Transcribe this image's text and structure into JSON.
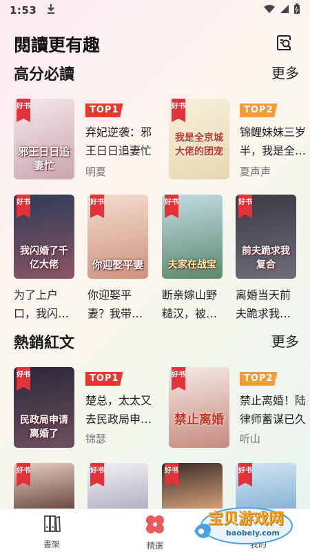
{
  "status": {
    "time": "1:53"
  },
  "header": {
    "title": "閱讀更有趣"
  },
  "sections": [
    {
      "title": "高分必讀",
      "more": "更多"
    },
    {
      "title": "熱銷紅文",
      "more": "更多"
    }
  ],
  "badge": "好书",
  "top_books_1": [
    {
      "rank": "TOP1",
      "title_line1": "弃妃逆袭：邪",
      "title_line2": "王日日追妻忙",
      "author": "明夏",
      "cover_text": "邪王日日追妻忙",
      "colors": [
        "#f3e6e8",
        "#c9a3ad"
      ]
    },
    {
      "rank": "TOP2",
      "title_line1": "锦鲤妹妹三岁",
      "title_line2": "半，我是全…",
      "author": "夏声声",
      "cover_text": "我是全京城大佬的团宠",
      "colors": [
        "#f6f0da",
        "#e9dcb7"
      ]
    }
  ],
  "grid_1": [
    {
      "cover_text": "我闪婚了千亿大佬",
      "line1": "为了上户",
      "line2": "口，我闪…",
      "colors": [
        "#32405a",
        "#8a5565"
      ]
    },
    {
      "cover_text": "你迎娶平妻",
      "line1": "你迎娶平",
      "line2": "妻？我带…",
      "colors": [
        "#f0d6c6",
        "#d49b87"
      ]
    },
    {
      "cover_text": "夫家在战宝",
      "line1": "断亲嫁山野",
      "line2": "糙汉，被…",
      "colors": [
        "#bcd7e0",
        "#5f8f73"
      ]
    },
    {
      "cover_text": "前夫跪求我复合",
      "line1": "离婚当天前",
      "line2": "夫跪求我…",
      "colors": [
        "#3e3a48",
        "#6d6a78"
      ]
    }
  ],
  "top_books_2": [
    {
      "rank": "TOP1",
      "title_line1": "楚总，太太又",
      "title_line2": "去民政局申…",
      "author": "锦瑟",
      "cover_text": "民政局申请离婚了",
      "colors": [
        "#2c2a3a",
        "#6b4e5e"
      ]
    },
    {
      "rank": "TOP2",
      "title_line1": "禁止离婚！陆",
      "title_line2": "律师蓄谋已久",
      "author": "听山",
      "cover_text": "禁止离婚",
      "colors": [
        "#f2e6e2",
        "#c98f85"
      ]
    }
  ],
  "grid_2": [
    {
      "colors": [
        "#e8d2c4",
        "#6b4a44"
      ]
    },
    {
      "colors": [
        "#f0eef2",
        "#b6b2c6"
      ]
    },
    {
      "colors": [
        "#3a2c28",
        "#d4a07a"
      ]
    },
    {
      "colors": [
        "#cfe3f2",
        "#8ab6d8"
      ]
    }
  ],
  "nav": [
    {
      "label": "書架",
      "icon": "bookshelf-icon"
    },
    {
      "label": "精選",
      "icon": "featured-icon"
    },
    {
      "label": "我的",
      "icon": "profile-icon"
    }
  ],
  "watermark": {
    "text": "宝贝游戏网",
    "url": "baobeiy.com"
  },
  "accent": "#e8372d"
}
